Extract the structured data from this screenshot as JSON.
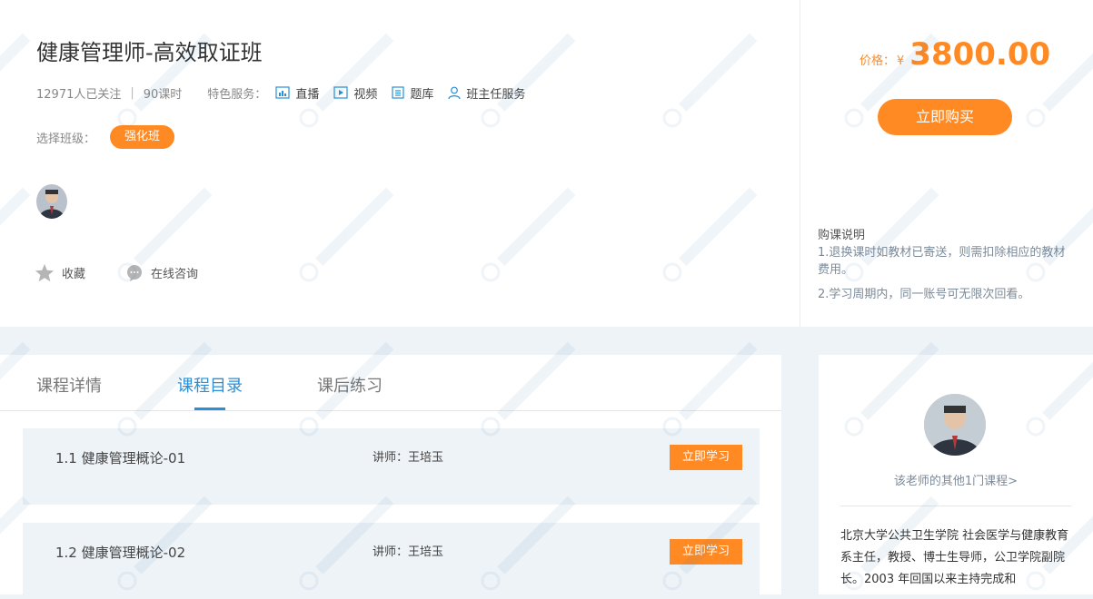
{
  "course": {
    "title": "健康管理师-高效取证班",
    "followers": "12971人已关注",
    "separator": "|",
    "hours": "90课时",
    "features_label": "特色服务：",
    "features": [
      {
        "label": "直播",
        "icon": "live-icon"
      },
      {
        "label": "视频",
        "icon": "video-icon"
      },
      {
        "label": "题库",
        "icon": "question-bank-icon"
      },
      {
        "label": "班主任服务",
        "icon": "head-teacher-icon"
      }
    ],
    "select_class_label": "选择班级：",
    "selected_class": "强化班",
    "actions": {
      "favorite": "收藏",
      "consult": "在线咨询"
    }
  },
  "purchase": {
    "price_label": "价格：",
    "currency": "¥",
    "price": "3800.00",
    "buy_button": "立即购买",
    "notice_title": "购课说明",
    "notice_items": [
      "1.退换课时如教材已寄送，则需扣除相应的教材费用。",
      "2.学习周期内，同一账号可无限次回看。"
    ]
  },
  "tabs": [
    {
      "label": "课程详情",
      "active": false
    },
    {
      "label": "课程目录",
      "active": true
    },
    {
      "label": "课后练习",
      "active": false
    }
  ],
  "lessons": [
    {
      "title": "1.1 健康管理概论-01",
      "teacher": "讲师：王培玉",
      "action": "立即学习"
    },
    {
      "title": "1.2 健康管理概论-02",
      "teacher": "讲师：王培玉",
      "action": "立即学习"
    }
  ],
  "teacher": {
    "other_courses_link": "该老师的其他1门课程>",
    "bio": "北京大学公共卫生学院 社会医学与健康教育系主任，教授、博士生导师，公卫学院副院长。2003 年回国以来主持完成和"
  },
  "colors": {
    "accent": "#ff8a24",
    "tab_active": "#2a8fd6",
    "background": "#eef3f7"
  }
}
